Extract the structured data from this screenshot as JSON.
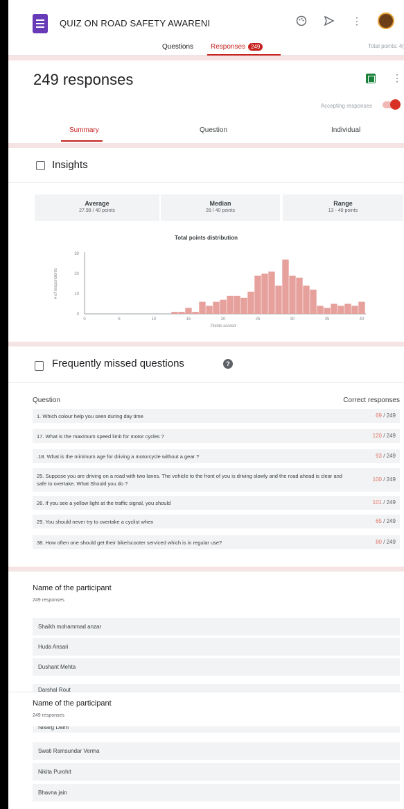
{
  "header": {
    "form_title": "QUIZ ON ROAD SAFETY AWARENI",
    "tab_questions": "Questions",
    "tab_responses": "Responses",
    "responses_badge": "249",
    "total_points": "Total points: 4("
  },
  "summary_header": {
    "count": "249 responses",
    "accepting_label": "Accepting responses",
    "accepting_on": true,
    "tabs": [
      "Summary",
      "Question",
      "Individual"
    ],
    "active_tab": "Summary"
  },
  "insights": {
    "title": "Insights",
    "stats": [
      {
        "label": "Average",
        "value": "27.98 / 40 points"
      },
      {
        "label": "Median",
        "value": "28 / 40 points"
      },
      {
        "label": "Range",
        "value": "13 - 40 points"
      }
    ]
  },
  "chart_data": {
    "type": "bar",
    "title": "Total points distribution",
    "xlabel": "Points scored",
    "ylabel": "# of respondents",
    "xlim": [
      0,
      40
    ],
    "ylim": [
      0,
      30
    ],
    "xticks": [
      0,
      5,
      10,
      15,
      20,
      25,
      30,
      35,
      40
    ],
    "yticks": [
      0,
      10,
      20,
      30
    ],
    "color": "#e6a19c",
    "x": [
      13,
      14,
      15,
      16,
      17,
      18,
      19,
      20,
      21,
      22,
      23,
      24,
      25,
      26,
      27,
      28,
      29,
      30,
      31,
      32,
      33,
      34,
      35,
      36,
      37,
      38,
      39,
      40
    ],
    "values": [
      1,
      1,
      3,
      1,
      6,
      4,
      6,
      7,
      9,
      9,
      8,
      11,
      19,
      20,
      21,
      14,
      27,
      19,
      18,
      14,
      12,
      4,
      3,
      5,
      4,
      5,
      4,
      6
    ]
  },
  "missed": {
    "title": "Frequently missed questions",
    "col_question": "Question",
    "col_correct": "Correct responses",
    "rows": [
      {
        "q": "1. Which colour help you seen during day time",
        "correct": "69",
        "total": "/ 249"
      },
      {
        "q": "17. What is the maximum speed limit for motor cycles ?",
        "correct": "120",
        "total": "/ 249"
      },
      {
        "q": ".18. What is the minimum age for driving a motorcycle without a gear ?",
        "correct": "93",
        "total": "/ 249"
      },
      {
        "q": "25. Suppose you are driving on a road with two lanes. The vehicle to the front of you is driving slowly and the road ahead is clear and safe to overtake. What Should you do ?",
        "correct": "100",
        "total": "/ 249"
      },
      {
        "q": "26. If you see a yellow light at the traffic signal, you should",
        "correct": "101",
        "total": "/ 249"
      },
      {
        "q": "29. You should never try to overtake a cyclist when",
        "correct": "65",
        "total": "/ 249"
      },
      {
        "q": "38. How often one should get their bike/scooter serviced which is in regular use?",
        "correct": "80",
        "total": "/ 249"
      }
    ]
  },
  "participants": {
    "title": "Name of the participant",
    "subtitle": "249 responses",
    "first_list": [
      "Shaikh mohammad anzar",
      "Huda Ansari",
      "Dushant Mehta",
      "Darshal Rout"
    ],
    "second_list": [
      "Nisarg Dalm",
      "Swati Ramsundar Verma",
      "Nikita Purohit",
      "Bhavna jain"
    ]
  }
}
